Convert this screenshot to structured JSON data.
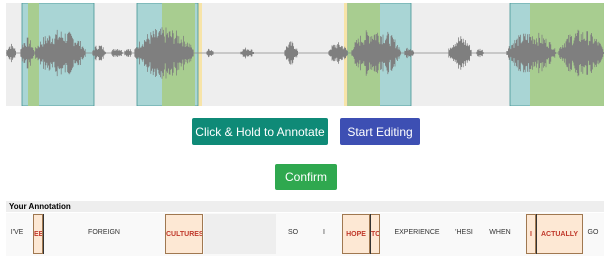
{
  "waveform": {
    "region_colors": {
      "cyan": "#a6d4d4",
      "green": "#a8cc8c",
      "yellow": "#f7e3a3"
    },
    "wave_color": "#7f7f7f"
  },
  "buttons": {
    "annotate_label": "Click & Hold to Annotate",
    "edit_label": "Start Editing",
    "confirm_label": "Confirm"
  },
  "annotation": {
    "header": "Your Annotation",
    "words": [
      "I'VE",
      "EE",
      "FOREIGN",
      "CULTURES",
      "SO",
      "I",
      "HOPE",
      "TO",
      "EXPERIENCE",
      "'HESI",
      "WHEN",
      "I",
      "ACTUALLY",
      "GO"
    ],
    "highlighted": [
      "EE",
      "CULTURES",
      "HOPE",
      "TO",
      "I",
      "ACTUALLY"
    ]
  }
}
